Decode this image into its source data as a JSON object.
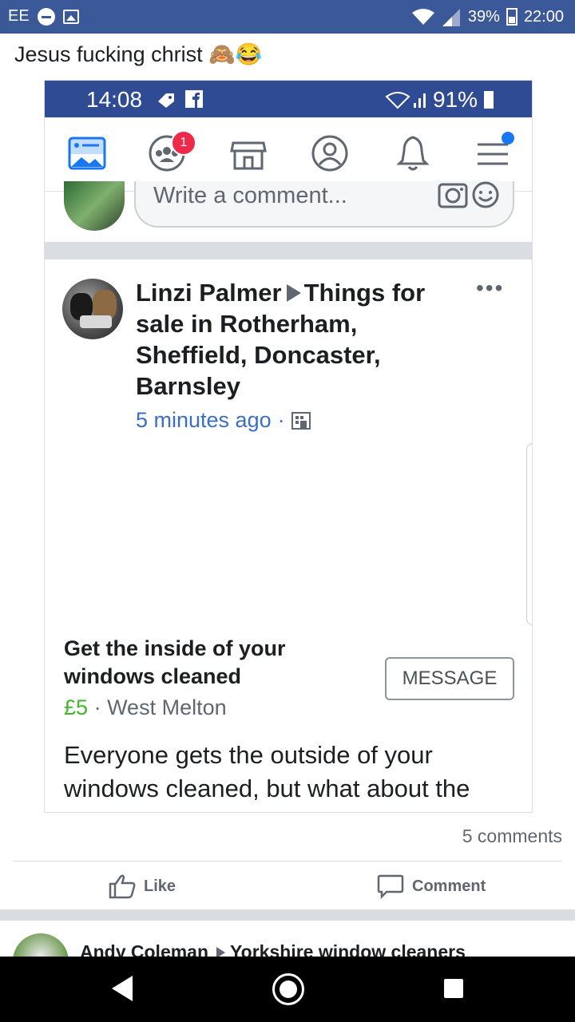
{
  "status_bar": {
    "carrier": "EE",
    "battery": "39%",
    "time": "22:00"
  },
  "post_caption": "Jesus fucking christ",
  "caption_emojis": [
    "🙈",
    "😂"
  ],
  "embedded": {
    "status_bar": {
      "time": "14:08",
      "battery": "91%"
    },
    "nav": {
      "notification_badge": "1"
    },
    "comment_input": {
      "placeholder": "Write a comment..."
    },
    "post": {
      "author": "Linzi Palmer",
      "group": "Things for sale in Rotherham, Sheffield, Doncaster, Barnsley",
      "timestamp": "5 minutes ago",
      "more": "•••",
      "listing_title": "Get the inside of your windows cleaned",
      "message_button": "MESSAGE",
      "price": "£5",
      "location": "West Melton",
      "body": "Everyone gets the outside of your windows cleaned, but what about the insides,, if you forgot to ask your window cleaner or just don’t fancy the job let us do it for you from as little as £5 plz comment if interested or call 07732722522,,thanks for reading"
    }
  },
  "comments_count": "5 comments",
  "actions": {
    "like": "Like",
    "comment": "Comment"
  },
  "next_post": {
    "author": "Andy Coleman",
    "group": "Yorkshire window cleaners"
  },
  "colors": {
    "facebook_blue": "#3b5998",
    "link_blue": "#3a6fc3",
    "price_green": "#42b72a",
    "badge_red": "#f02849"
  }
}
